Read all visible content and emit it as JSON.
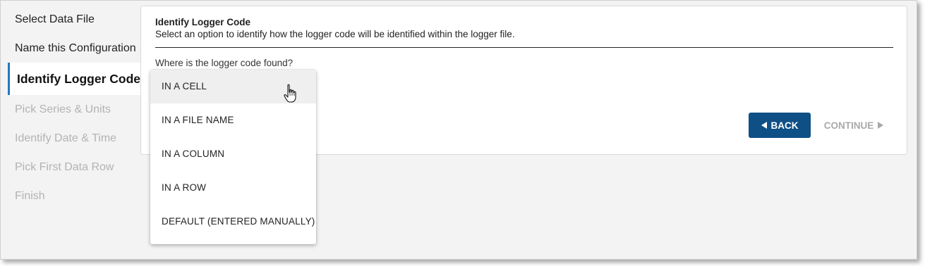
{
  "steps": [
    {
      "label": "Select Data File",
      "state": "done"
    },
    {
      "label": "Name this Configuration",
      "state": "done"
    },
    {
      "label": "Identify Logger Code",
      "state": "active"
    },
    {
      "label": "Pick Series & Units",
      "state": "disabled"
    },
    {
      "label": "Identify Date & Time",
      "state": "disabled"
    },
    {
      "label": "Pick First Data Row",
      "state": "disabled"
    },
    {
      "label": "Finish",
      "state": "disabled"
    }
  ],
  "card": {
    "title": "Identify Logger Code",
    "subtitle": "Select an option to identify how the logger code will be identified within the logger file.",
    "question": "Where is the logger code found?"
  },
  "buttons": {
    "back_label": "BACK",
    "continue_label": "CONTINUE"
  },
  "dropdown": {
    "options": [
      "IN A CELL",
      "IN A FILE NAME",
      "IN A COLUMN",
      "IN A ROW",
      "DEFAULT (ENTERED MANUALLY)"
    ],
    "hovered_index": 0
  },
  "colors": {
    "accent": "#1f78c1",
    "primary_button": "#0e4f86",
    "disabled_text": "#b3b3b3"
  },
  "icons": {
    "back": "triangle-left-icon",
    "continue": "triangle-right-icon",
    "cursor": "hand-pointer-icon"
  }
}
